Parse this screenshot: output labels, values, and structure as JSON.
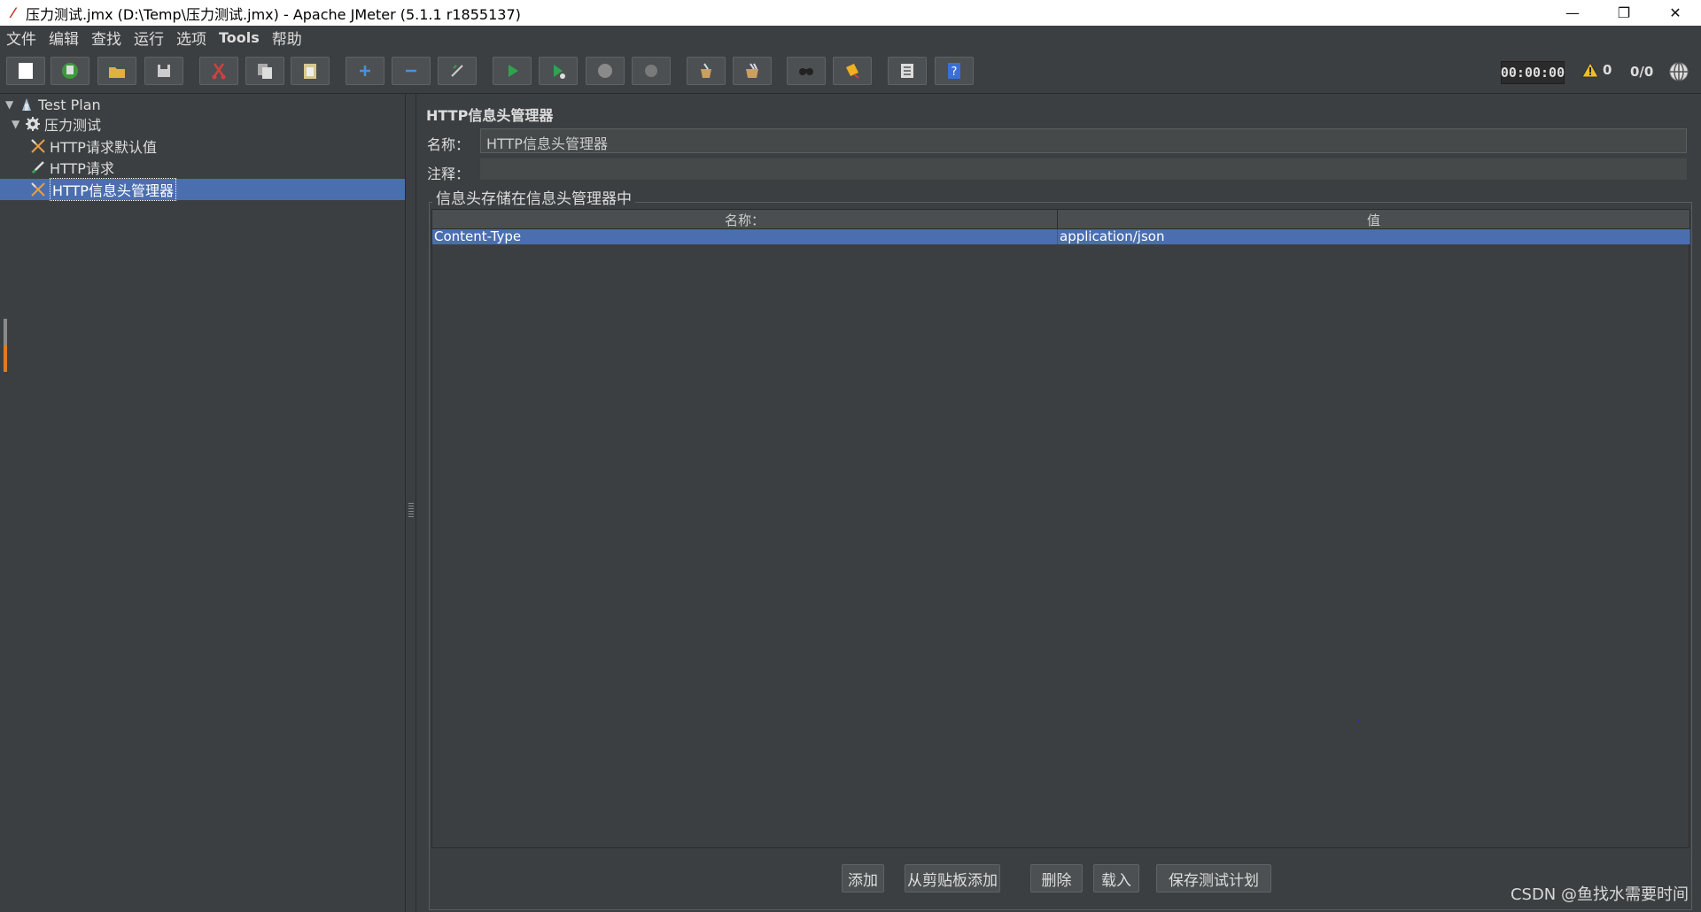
{
  "window": {
    "title": "压力测试.jmx (D:\\Temp\\压力测试.jmx) - Apache JMeter (5.1.1 r1855137)",
    "minimize": "—",
    "restore": "❐",
    "close": "✕"
  },
  "menu": [
    "文件",
    "编辑",
    "查找",
    "运行",
    "选项",
    "Tools",
    "帮助"
  ],
  "toolbar": {
    "buttons": [
      {
        "name": "new-icon",
        "color": "#ffffff"
      },
      {
        "name": "templates-icon",
        "color": "#3c9a3c"
      },
      {
        "name": "open-icon",
        "color": "#e0b040"
      },
      {
        "name": "save-icon",
        "color": "#cccccc"
      },
      {
        "name": "cut-icon",
        "color": "#d04040"
      },
      {
        "name": "copy-icon",
        "color": "#cccccc"
      },
      {
        "name": "paste-icon",
        "color": "#d8c890"
      },
      {
        "name": "expand-icon",
        "color": "#4a90d9"
      },
      {
        "name": "collapse-icon",
        "color": "#4a90d9"
      },
      {
        "name": "toggle-icon",
        "color": "#cccccc"
      },
      {
        "name": "start-icon",
        "color": "#2ea44f"
      },
      {
        "name": "start-no-pause-icon",
        "color": "#2ea44f"
      },
      {
        "name": "stop-icon",
        "color": "#8a8a8a"
      },
      {
        "name": "shutdown-icon",
        "color": "#8a8a8a"
      },
      {
        "name": "clear-icon",
        "color": "#c8a060"
      },
      {
        "name": "clear-all-icon",
        "color": "#c8a060"
      },
      {
        "name": "search-icon",
        "color": "#444444"
      },
      {
        "name": "reset-search-icon",
        "color": "#f0b020"
      },
      {
        "name": "function-helper-icon",
        "color": "#cccccc"
      },
      {
        "name": "help-icon",
        "color": "#3a6fd8"
      }
    ],
    "timer": "00:00:00",
    "warnings": "0",
    "threads": "0/0"
  },
  "tree": {
    "items": [
      {
        "label": "Test Plan",
        "icon": "test-plan-icon",
        "toggle": "▼"
      },
      {
        "label": "压力测试",
        "icon": "thread-group-icon",
        "toggle": "▼"
      },
      {
        "label": "HTTP请求默认值",
        "icon": "config-element-icon"
      },
      {
        "label": "HTTP请求",
        "icon": "sampler-icon"
      },
      {
        "label": "HTTP信息头管理器",
        "icon": "config-element-icon"
      }
    ]
  },
  "editor": {
    "title": "HTTP信息头管理器",
    "name_label": "名称：",
    "name_value": "HTTP信息头管理器",
    "comment_label": "注释：",
    "comment_value": "",
    "group_title": "信息头存储在信息头管理器中",
    "table": {
      "columns": [
        "名称：",
        "值"
      ],
      "rows": [
        [
          "Content-Type",
          "application/json"
        ]
      ]
    },
    "buttons": [
      "添加",
      "从剪贴板添加",
      "删除",
      "载入",
      "保存测试计划"
    ]
  },
  "watermark": "CSDN @鱼找水需要时间"
}
